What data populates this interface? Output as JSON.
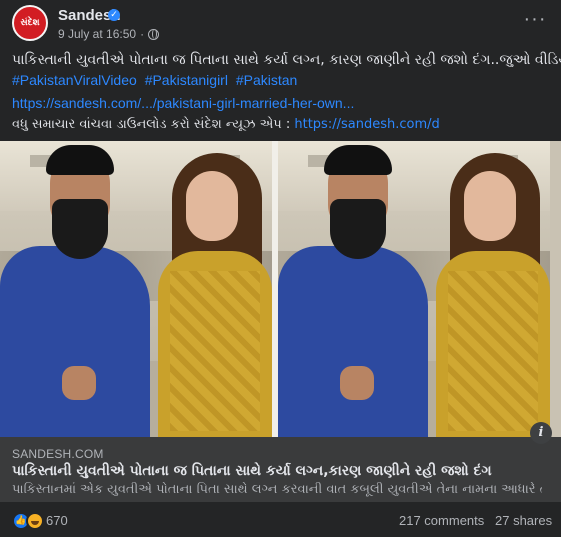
{
  "post": {
    "page_name": "Sandesh",
    "avatar_text": "સંદેશ",
    "timestamp": "9 July at 16:50",
    "privacy_icon": "globe-icon",
    "more_icon": "more-options-icon",
    "text_line1": "પાકિસ્તાની યુવતીએ પોતાના જ પિતાના સાથે કર્યા લગ્ન, કારણ જાણીને રહી જશો દંગ..જુઓ વીડિયો",
    "hashtags": [
      "#PakistanViralVideo",
      "#Pakistanigirl",
      "#Pakistan"
    ],
    "link_url": "https://sandesh.com/.../pakistani-girl-married-her-own...",
    "app_line_prefix": "વધુ સમાચાર વાંચવા ડાઉનલોડ કરો સંદેશ ન્યૂઝ એપ : ",
    "app_link": "https://sandesh.com/d"
  },
  "link_preview": {
    "domain": "SANDESH.COM",
    "title": "પાકિસ્તાની યુવતીએ પોતાના જ પિતાના સાથે કર્યા લગ્ન,કારણ જાણીને રહી જશો દંગ",
    "description": "પાકિસ્તાનમાં એક યુવતીએ પોતાના પિતા સાથે લગ્ન કરવાની વાત કબૂલી યુવતીએ તેના નામના આધારે તે...",
    "info_label": "i"
  },
  "reactions": {
    "count": "670",
    "icons": [
      "like-icon",
      "haha-icon"
    ],
    "comments": "217 comments",
    "shares": "27 shares"
  },
  "colors": {
    "background": "#242526",
    "link_blue": "#2d88ff",
    "brand_red": "#d21d23"
  }
}
